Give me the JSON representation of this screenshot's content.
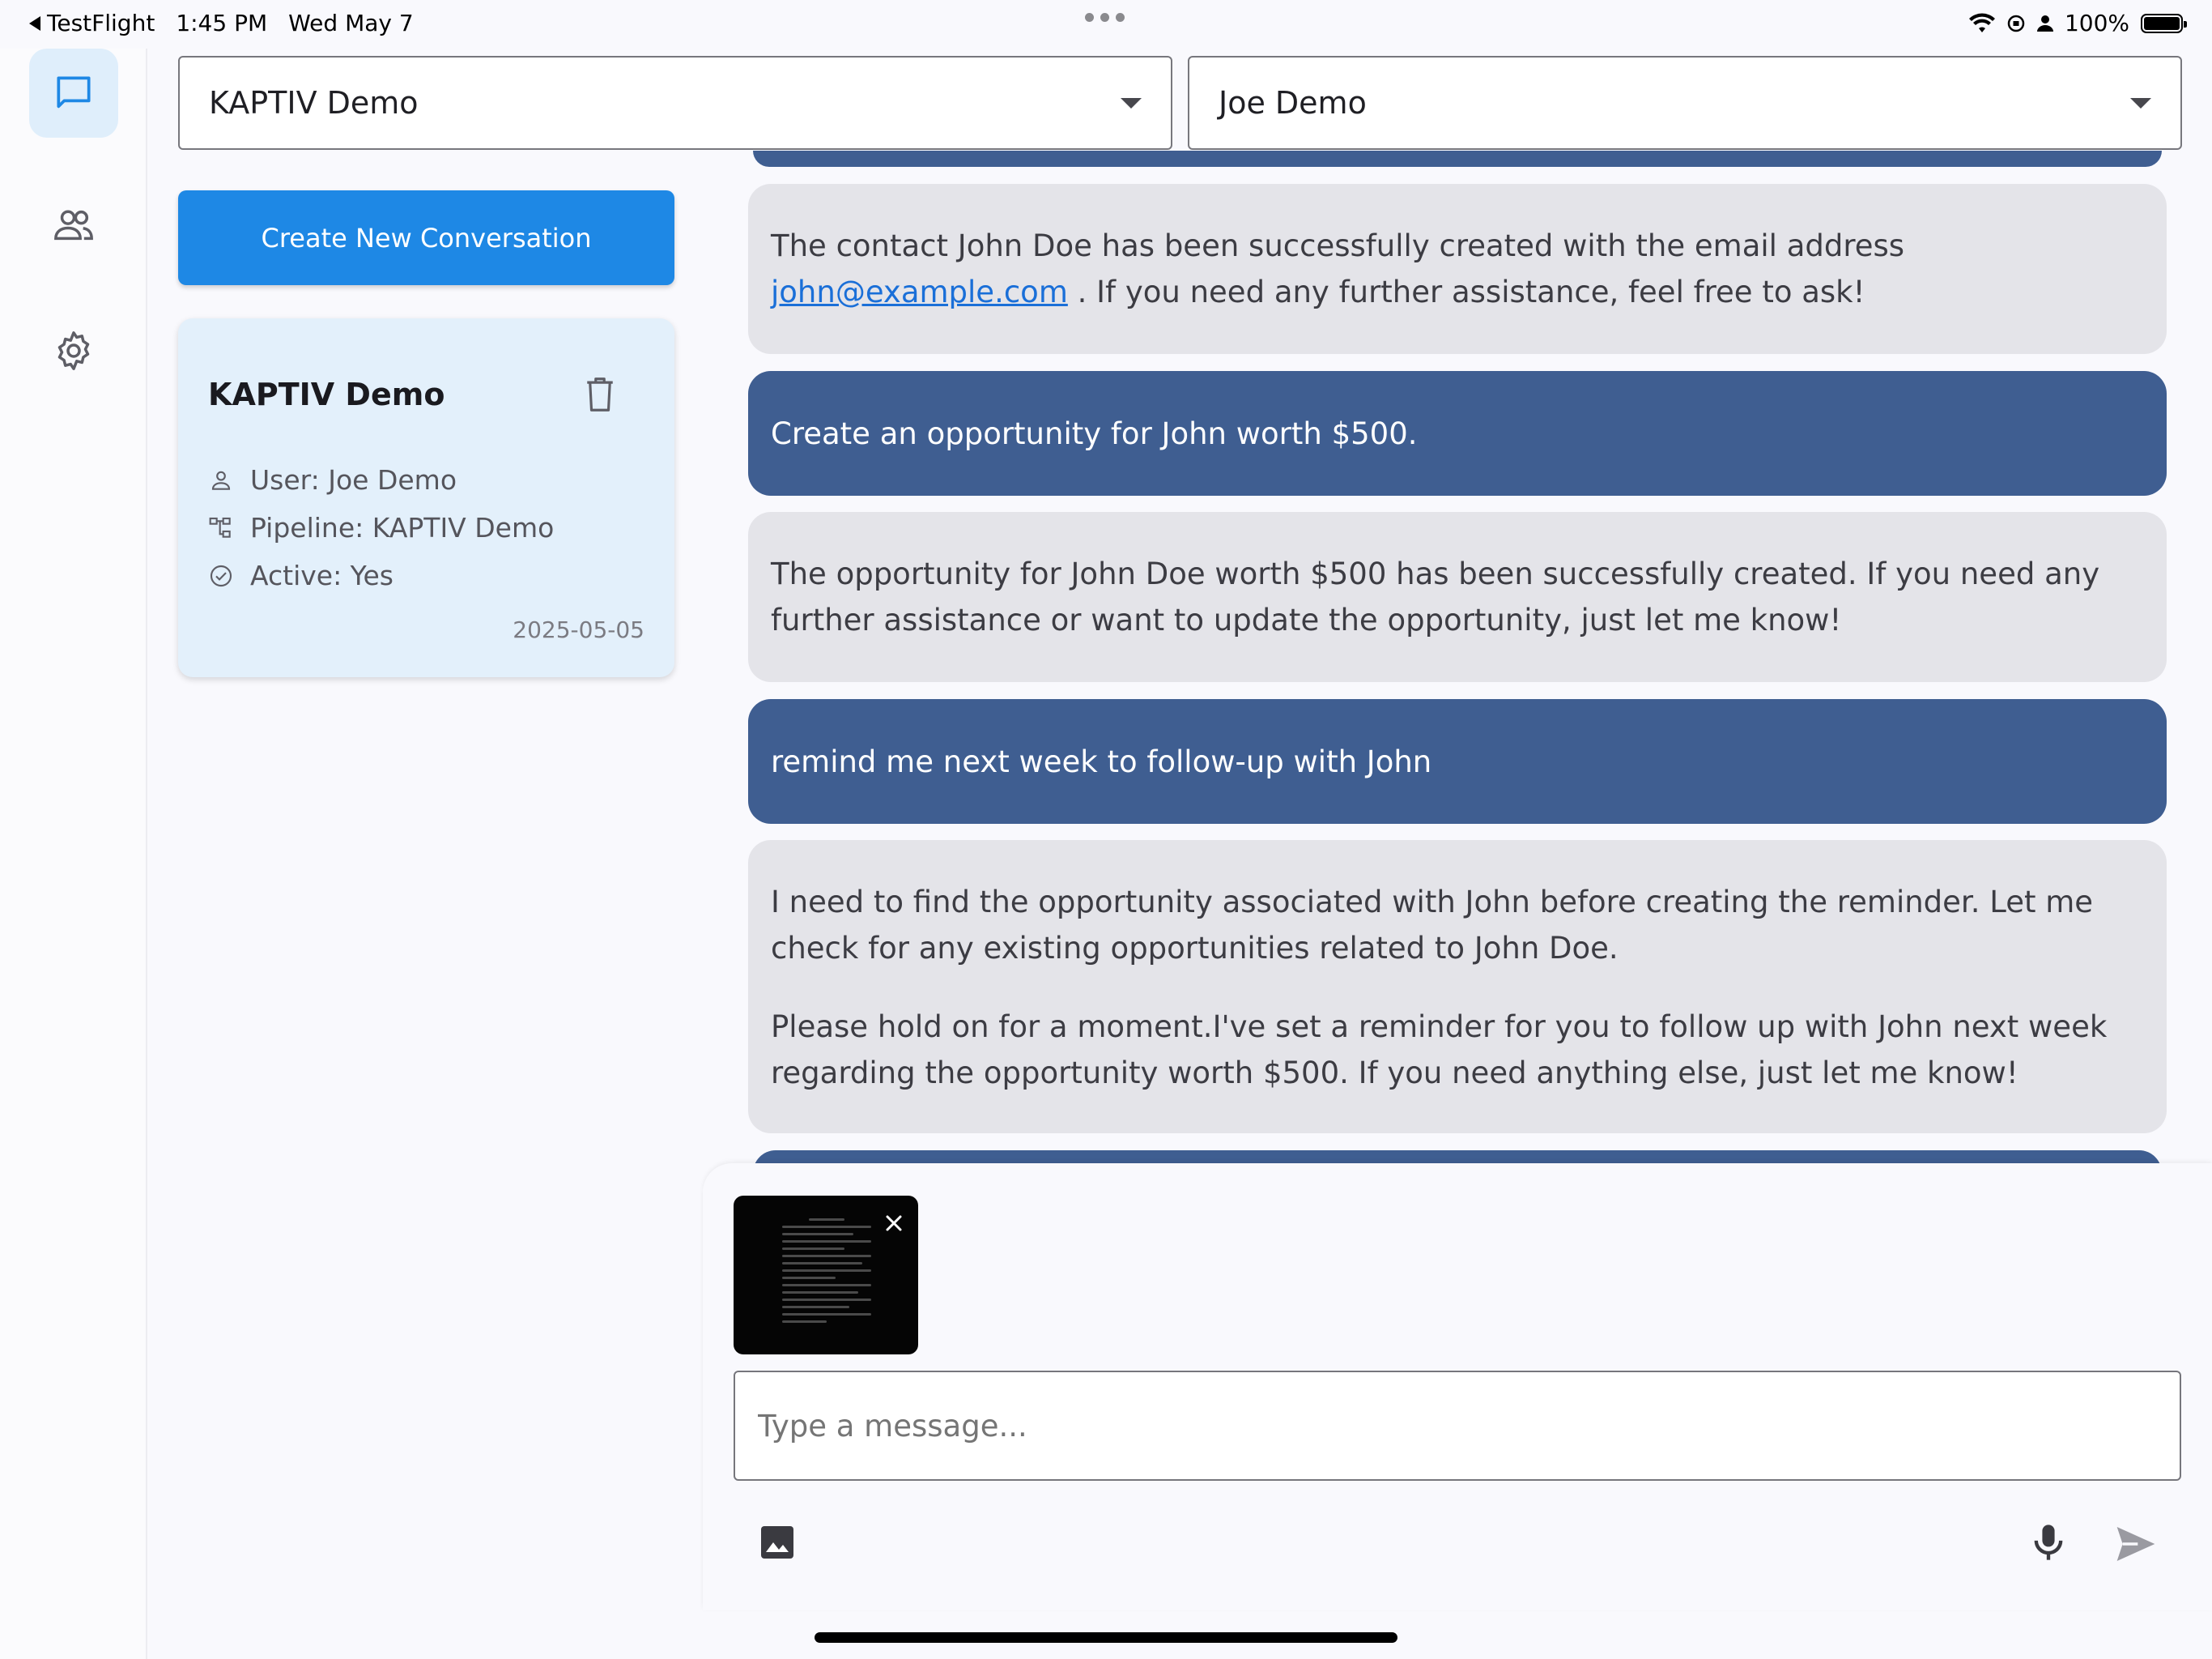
{
  "status_bar": {
    "back_app": "TestFlight",
    "time": "1:45 PM",
    "date": "Wed May 7",
    "battery": "100%"
  },
  "header": {
    "pipeline_select": "KAPTIV Demo",
    "user_select": "Joe Demo"
  },
  "sidebar": {
    "create_button": "Create New Conversation",
    "conversation": {
      "title": "KAPTIV Demo",
      "user": "User: Joe Demo",
      "pipeline": "Pipeline: KAPTIV Demo",
      "active": "Active: Yes",
      "date": "2025-05-05"
    }
  },
  "messages": {
    "m1_before": "The contact John Doe has been successfully created with the email address",
    "m1_link": "john@example.com",
    "m1_after": " . If you need any further assistance, feel free to ask!",
    "m2": "Create an opportunity for John worth $500.",
    "m3": "The opportunity for John Doe worth $500 has been successfully created. If you need any further assistance or want to update the opportunity, just let me know!",
    "m4": "remind me next week to follow-up with John",
    "m5_p1": "I need to find the opportunity associated with John before creating the reminder. Let me check for any existing opportunities related to John Doe.",
    "m5_p2": "Please hold on for a moment.I've set a reminder for you to follow up with John next week regarding the opportunity worth $500. If you need anything else, just let me know!"
  },
  "composer": {
    "placeholder": "Type a message..."
  },
  "colors": {
    "accent": "#1e88e5",
    "user_bubble": "#3f5e91",
    "bot_bubble": "#e4e4e9",
    "card": "#e3f0fb"
  }
}
